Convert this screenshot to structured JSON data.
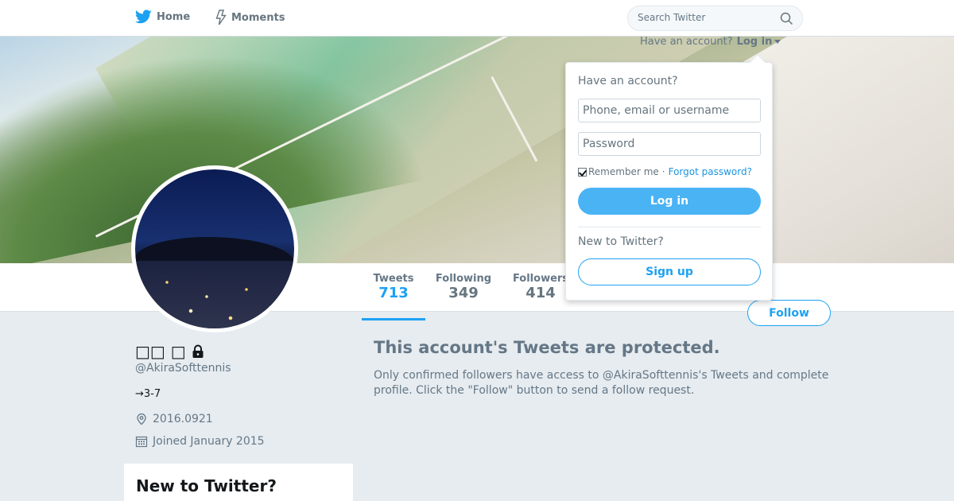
{
  "topbar": {
    "home_label": "Home",
    "moments_label": "Moments",
    "search_placeholder": "Search Twitter"
  },
  "login_menu": {
    "prompt": "Have an account?",
    "toggle_label": "Log in",
    "title": "Have an account?",
    "username_placeholder": "Phone, email or username",
    "password_placeholder": "Password",
    "remember_label": "Remember me",
    "separator": "·",
    "forgot_label": "Forgot password?",
    "login_button": "Log in",
    "new_label": "New to Twitter?",
    "signup_button": "Sign up"
  },
  "stats": {
    "tweets_label": "Tweets",
    "tweets_value": "713",
    "following_label": "Following",
    "following_value": "349",
    "followers_label": "Followers",
    "followers_value": "414"
  },
  "follow_button": "Follow",
  "profile": {
    "name": "□□ □",
    "handle": "@AkiraSofttennis",
    "bio": "→3-7",
    "location": "2016.0921",
    "joined": "Joined January 2015"
  },
  "sidebar": {
    "new_to_twitter": "New to Twitter?"
  },
  "protected": {
    "title": "This account's Tweets are protected.",
    "text": "Only confirmed followers have access to @AkiraSofttennis's Tweets and complete profile. Click the \"Follow\" button to send a follow request."
  },
  "colors": {
    "brand": "#1da1f2",
    "page_background": "#e6ecf0",
    "muted_text": "#657786"
  }
}
